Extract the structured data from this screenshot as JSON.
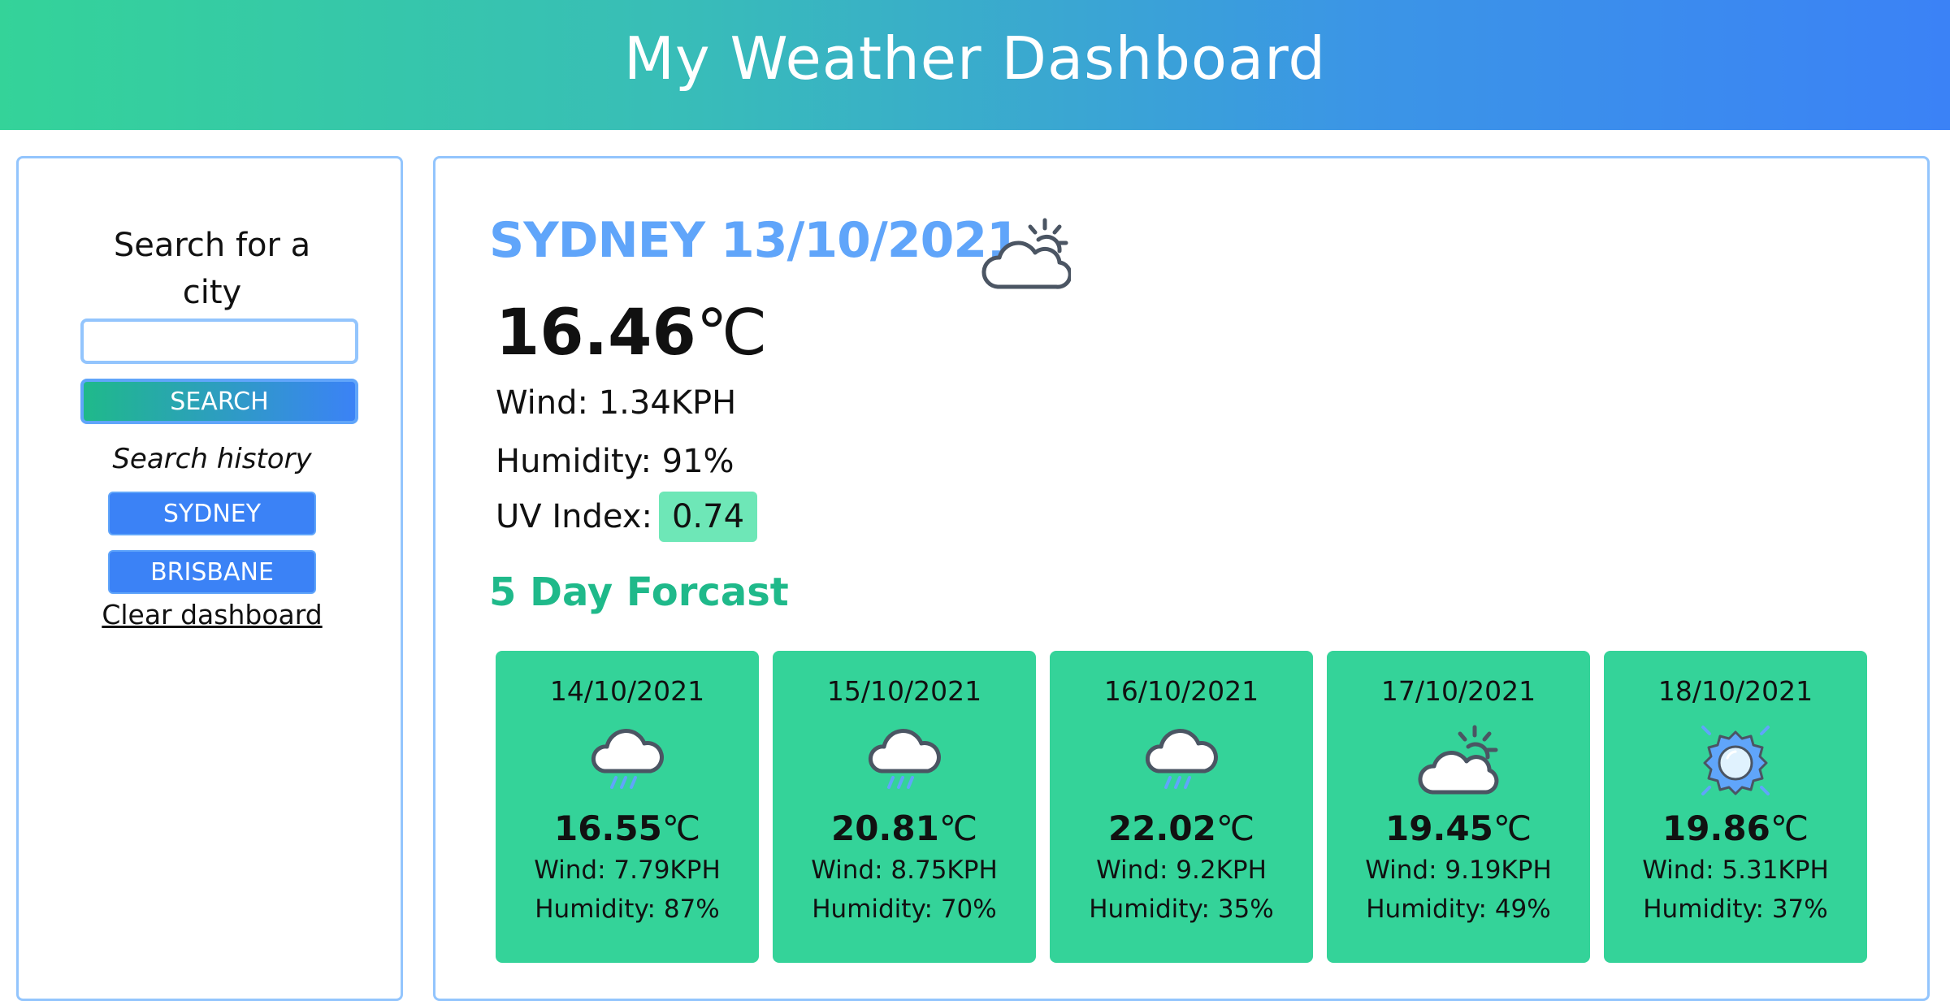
{
  "header": {
    "title": "My Weather Dashboard"
  },
  "sidebar": {
    "search_title": "Search for a city",
    "search_input": {
      "value": "",
      "placeholder": ""
    },
    "search_button": "SEARCH",
    "history_label": "Search history",
    "history": [
      {
        "label": "SYDNEY"
      },
      {
        "label": "BRISBANE"
      }
    ],
    "clear_link": "Clear dashboard"
  },
  "current": {
    "heading": "SYDNEY 13/10/2021",
    "icon": "cloud-sun-icon",
    "temp_value": "16.46",
    "temp_unit": "℃",
    "wind": "Wind: 1.34KPH",
    "humidity": "Humidity: 91%",
    "uv_label": "UV Index:",
    "uv_value": "0.74"
  },
  "forecast": {
    "title": "5 Day Forcast",
    "days": [
      {
        "date": "14/10/2021",
        "icon": "rain-cloud-icon",
        "temp": "16.55",
        "unit": "℃",
        "wind": "Wind: 7.79KPH",
        "humidity": "Humidity: 87%"
      },
      {
        "date": "15/10/2021",
        "icon": "rain-cloud-icon",
        "temp": "20.81",
        "unit": "℃",
        "wind": "Wind: 8.75KPH",
        "humidity": "Humidity: 70%"
      },
      {
        "date": "16/10/2021",
        "icon": "rain-cloud-icon",
        "temp": "22.02",
        "unit": "℃",
        "wind": "Wind: 9.2KPH",
        "humidity": "Humidity: 35%"
      },
      {
        "date": "17/10/2021",
        "icon": "cloud-sun-icon",
        "temp": "19.45",
        "unit": "℃",
        "wind": "Wind: 9.19KPH",
        "humidity": "Humidity: 49%"
      },
      {
        "date": "18/10/2021",
        "icon": "sun-icon",
        "temp": "19.86",
        "unit": "℃",
        "wind": "Wind: 5.31KPH",
        "humidity": "Humidity: 37%"
      }
    ]
  },
  "colors": {
    "accent_blue": "#3b82f6",
    "card_green": "#34d399",
    "title_green": "#1fb98a",
    "city_blue": "#60a5fa",
    "uv_badge": "#6ee7b7"
  }
}
